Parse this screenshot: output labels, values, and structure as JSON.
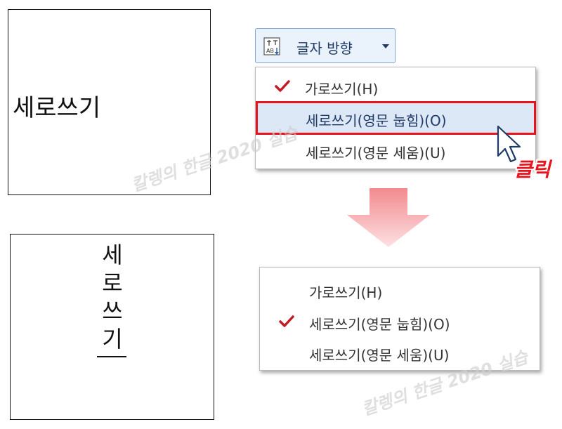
{
  "before": {
    "text": "세로쓰기"
  },
  "after": {
    "chars": [
      "세",
      "로",
      "쓰",
      "기"
    ]
  },
  "toolbar": {
    "label": "글자 방향",
    "icon": "text-direction-icon"
  },
  "menu_top": {
    "items": [
      {
        "label": "가로쓰기(H)",
        "checked": true
      },
      {
        "label": "세로쓰기(영문 눕힘)(O)",
        "checked": false,
        "highlighted": true
      },
      {
        "label": "세로쓰기(영문 세움)(U)",
        "checked": false
      }
    ]
  },
  "menu_bottom": {
    "items": [
      {
        "label": "가로쓰기(H)",
        "checked": false
      },
      {
        "label": "세로쓰기(영문 눕힘)(O)",
        "checked": true
      },
      {
        "label": "세로쓰기(영문 세움)(U)",
        "checked": false
      }
    ]
  },
  "annotation": {
    "click": "클릭"
  },
  "watermark": {
    "text": "칼렝의 한글 2020 실습"
  },
  "colors": {
    "highlight_border": "#e8131d",
    "check": "#c41a24",
    "button_bg": "#eaf2fc"
  }
}
